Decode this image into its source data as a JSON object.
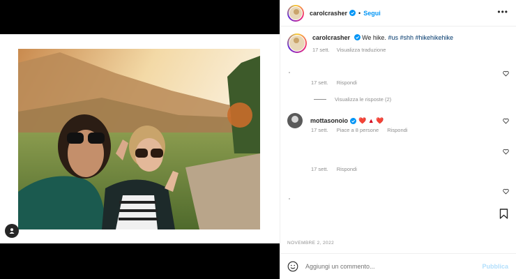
{
  "post": {
    "username": "carolcrasher",
    "follow_label": "Segui",
    "dot": "•",
    "more_label": "•••"
  },
  "caption": {
    "username": "carolcrasher",
    "text": "We hike. ",
    "hashtags": "#us #shh #hikehikehike",
    "time": "17 sett.",
    "translate_label": "Visualizza traduzione"
  },
  "comments": [
    {
      "time": "17 sett.",
      "reply_label": "Rispondi",
      "view_replies_label": "Visualizza le risposte (2)"
    },
    {
      "username": "mottasonoio",
      "emojis": "❤️ ▲ ❤️",
      "time": "17 sett.",
      "likes_label": "Piace a 8 persone",
      "reply_label": "Rispondi"
    },
    {
      "time": "17 sett.",
      "reply_label": "Rispondi"
    }
  ],
  "date_label": "NOVEMBRE 2, 2022",
  "comment_box": {
    "placeholder": "Aggiungi un commento...",
    "publish_label": "Pubblica"
  },
  "colors": {
    "accent": "#0095f6",
    "publish_disabled": "#b2dffc",
    "hashtag": "#00376b",
    "muted": "#8e8e8e"
  }
}
